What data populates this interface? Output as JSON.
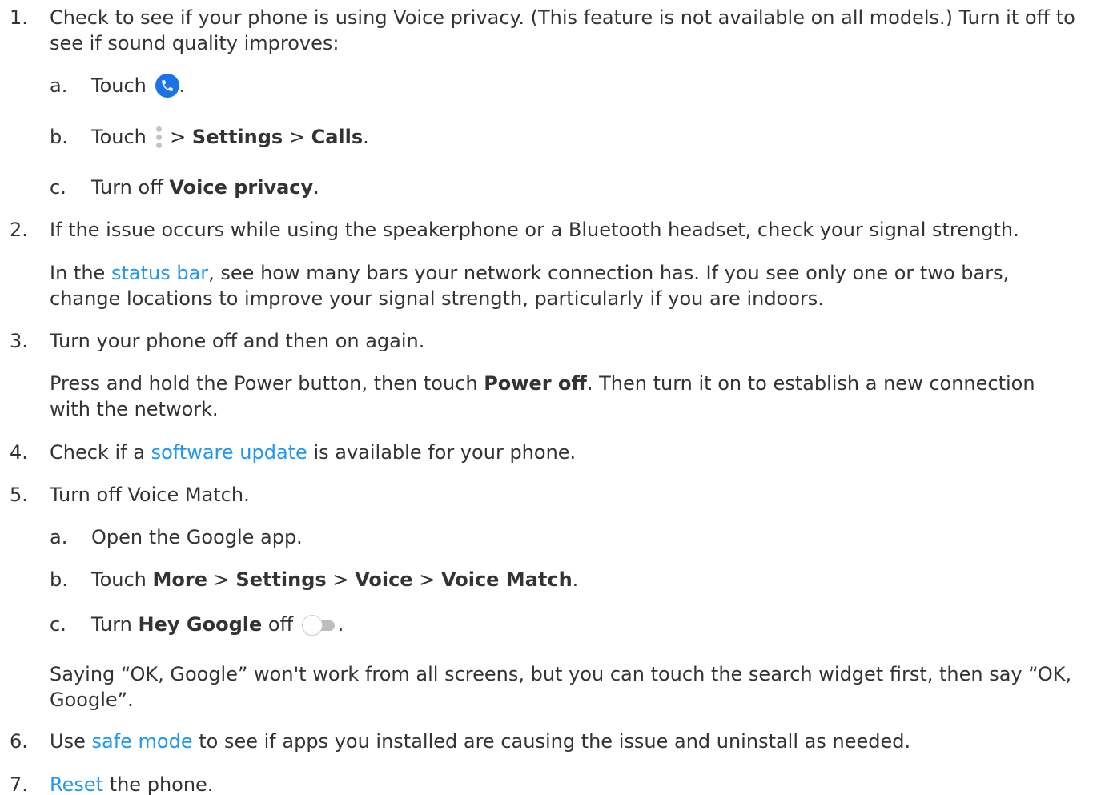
{
  "steps": [
    {
      "num": "1.",
      "text_a": "Check to see if your phone is using Voice privacy. (This feature is not available on all models.) Turn it off to see if sound quality improves:",
      "subs": [
        {
          "num": "a.",
          "pre": "Touch",
          "post": "."
        },
        {
          "num": "b.",
          "pre": "Touch",
          "sep1": ">",
          "bold1": "Settings",
          "sep2": ">",
          "bold2": "Calls",
          "post": "."
        },
        {
          "num": "c.",
          "pre": "Turn off",
          "bold1": "Voice privacy",
          "post": "."
        }
      ]
    },
    {
      "num": "2.",
      "text_a": "If the issue occurs while using the speakerphone or a Bluetooth headset, check your signal strength.",
      "para_pre": "In the",
      "para_link": "status bar",
      "para_post": ", see how many bars your network connection has. If you see only one or two bars, change locations to improve your signal strength, particularly if you are indoors."
    },
    {
      "num": "3.",
      "text_a": "Turn your phone off and then on again.",
      "para_pre": "Press and hold the Power button, then touch",
      "para_bold": "Power off",
      "para_post": ". Then turn it on to establish a new connection with the network."
    },
    {
      "num": "4.",
      "pre": "Check if a",
      "link": "software update",
      "post": "is available for your phone."
    },
    {
      "num": "5.",
      "text_a": "Turn off Voice Match.",
      "subs": [
        {
          "num": "a.",
          "text": "Open the Google app."
        },
        {
          "num": "b.",
          "pre": "Touch",
          "bold1": "More",
          "sep1": ">",
          "bold2": "Settings",
          "sep2": ">",
          "bold3": "Voice",
          "sep3": ">",
          "bold4": "Voice Match",
          "post": "."
        },
        {
          "num": "c.",
          "pre": "Turn",
          "bold1": "Hey Google",
          "mid": "off",
          "post": "."
        }
      ],
      "note": "Saying “OK, Google” won't work from all screens, but you can touch the search widget first, then say “OK, Google”."
    },
    {
      "num": "6.",
      "pre": "Use",
      "link": "safe mode",
      "post": "to see if apps you installed are causing the issue and uninstall as needed."
    },
    {
      "num": "7.",
      "link": "Reset",
      "post": "the phone."
    }
  ],
  "icons": {
    "phone": "phone-app-icon",
    "menu": "more-options-icon",
    "toggle": "toggle-off-icon"
  },
  "colors": {
    "link": "#2196f3",
    "text": "#333333",
    "phone_icon_bg": "#1a73e8"
  }
}
